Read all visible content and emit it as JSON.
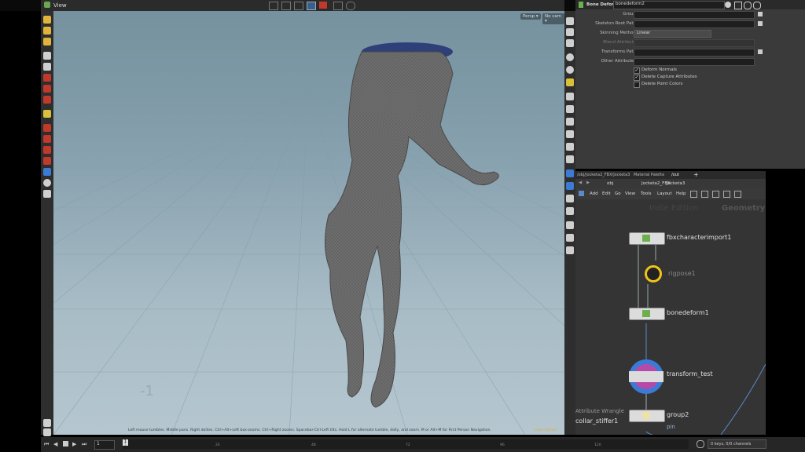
{
  "viewport": {
    "title": "View",
    "camera_btn": "Persp ▾",
    "cam_btn": "No cam ▾",
    "axis_label": "-1",
    "status_text": "Left mouse tumbles. Middle pans. Right dollies. Ctrl+Alt+Left box-zooms. Ctrl+Right zooms. Spacebar-Ctrl-Left tilts. Hold L for alternate tumble, dolly, and zoom.   M or Alt+M for First Person Navigation.",
    "status_right": "Indie Edition"
  },
  "parms": {
    "node_type": "Bone Deform",
    "node_name": "bonedeform2",
    "rows": [
      {
        "label": "Group",
        "value": ""
      },
      {
        "label": "Skeleton Root Path",
        "value": ""
      },
      {
        "label": "Skinning Method",
        "value": "Linear"
      },
      {
        "label": "Blend Attribute",
        "value": ""
      },
      {
        "label": "Transforms Path",
        "value": ""
      },
      {
        "label": "Other Attributes",
        "value": ""
      }
    ],
    "checks": [
      {
        "label": "Deform Normals",
        "checked": true
      },
      {
        "label": "Delete Capture Attributes",
        "checked": true
      },
      {
        "label": "Delete Point Colors",
        "checked": false
      }
    ]
  },
  "network": {
    "tabs": [
      "/obj/Jocketa2_FBX/Jocketa3",
      "Material Palette",
      "/out"
    ],
    "path": [
      "obj",
      "Jocketa2_FBX",
      "Jocketa3"
    ],
    "menu": [
      "Add",
      "Edit",
      "Go",
      "View",
      "Tools",
      "Layout",
      "Help"
    ],
    "watermark": "Indie Edition",
    "context": "Geometry",
    "nodes": [
      {
        "name": "fbxcharacterimport1"
      },
      {
        "name": "rigpose1"
      },
      {
        "name": "bonedeform1"
      },
      {
        "name": "transform_test"
      },
      {
        "name": "group2"
      }
    ],
    "side_labels": [
      "Attribute Wrangle",
      "collar_stiffer1",
      "pin"
    ]
  },
  "timeline": {
    "frame": "1",
    "ticks": [
      "1",
      "24",
      "48",
      "72",
      "96",
      "120"
    ],
    "keys": "0 keys, 0/0 channels"
  },
  "colors": {
    "accent": "#f0c419",
    "select": "#3b7bd6"
  }
}
